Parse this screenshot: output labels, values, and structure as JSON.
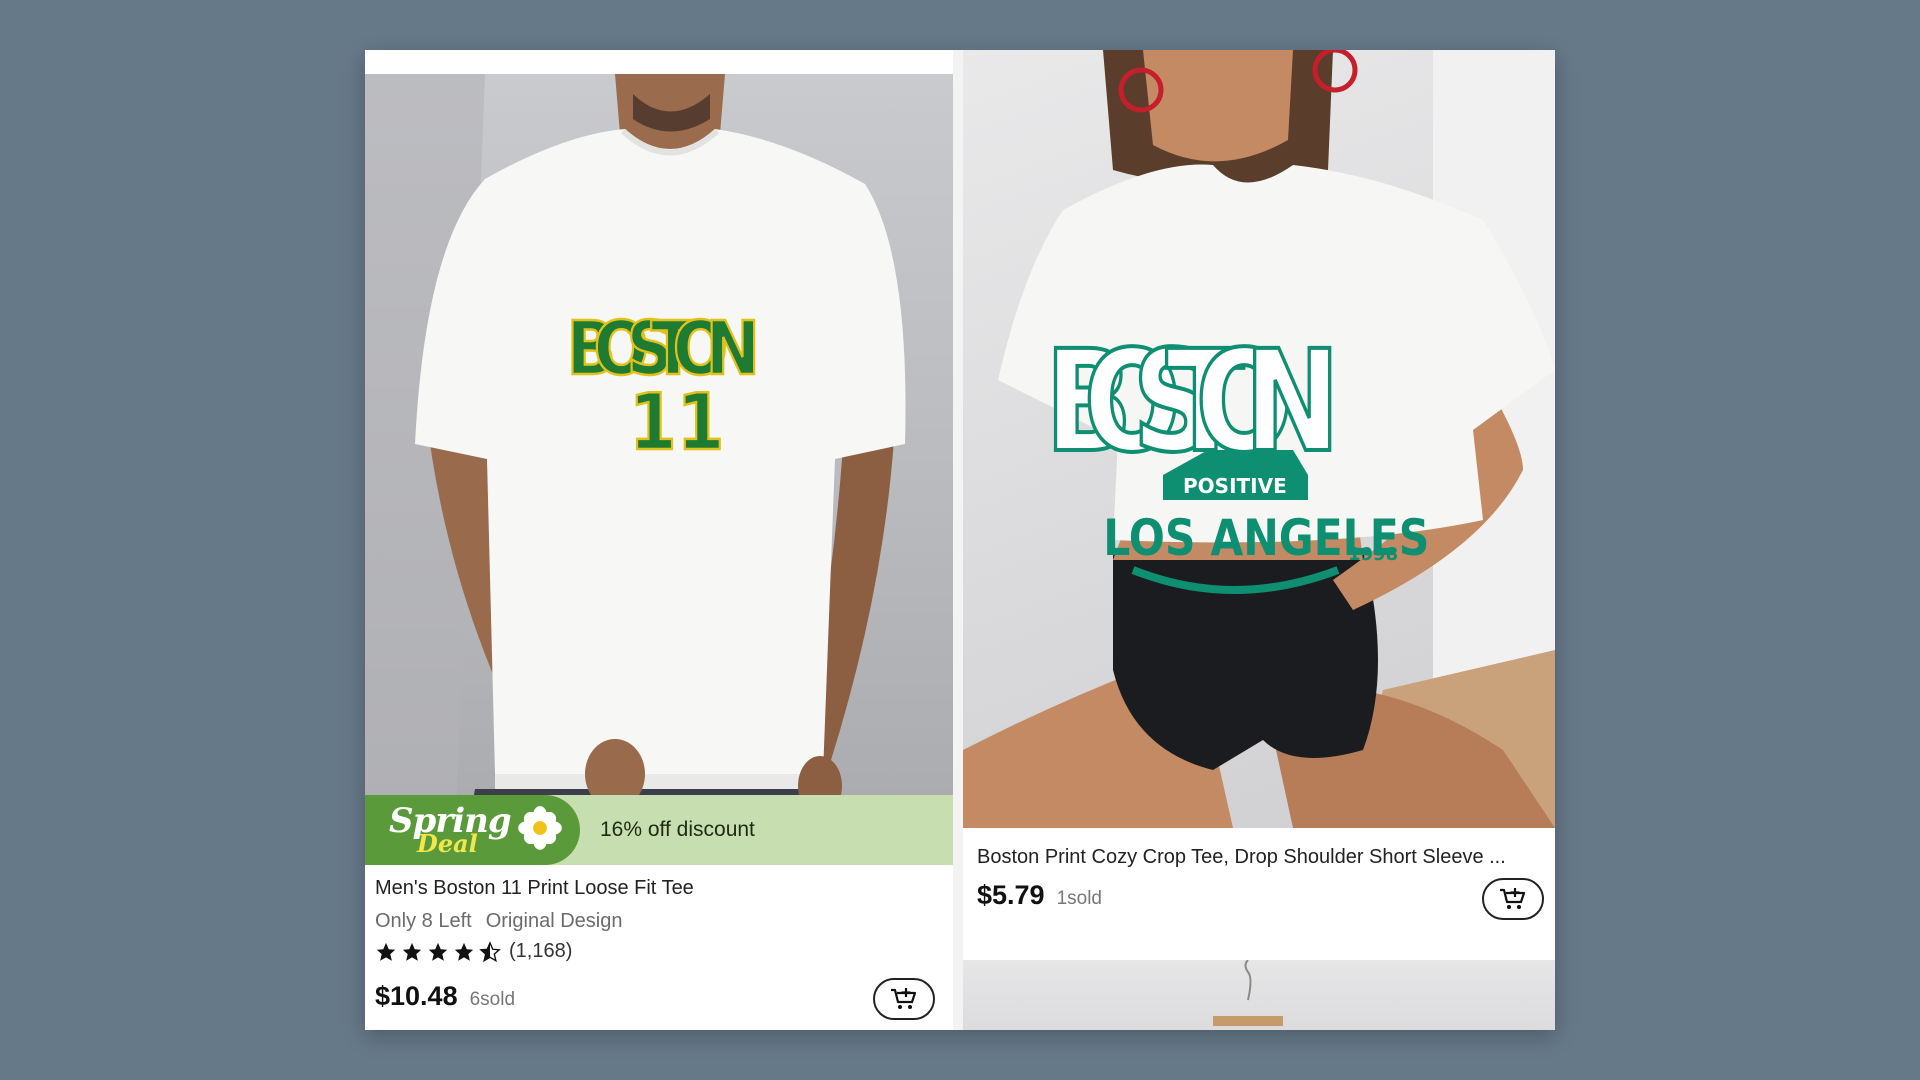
{
  "products": [
    {
      "title": "Men's Boston 11 Print Loose Fit Tee",
      "promo": {
        "badge_main": "Spring",
        "badge_sub": "Deal",
        "text": "16% off discount"
      },
      "stock": "Only 8 Left",
      "tag": "Original Design",
      "rating": {
        "stars": 4.5,
        "count": "(1,168)"
      },
      "price": "$10.48",
      "sold": "6sold",
      "print": {
        "word": "BOSTON",
        "number": "11"
      }
    },
    {
      "title": "Boston Print Cozy Crop Tee, Drop Shoulder Short Sleeve ...",
      "price": "$5.79",
      "sold": "1sold",
      "print": {
        "word": "BOSTON",
        "badge": "POSITIVE",
        "city": "LOS ANGELES",
        "year": "1998"
      }
    }
  ],
  "colors": {
    "background": "#667989",
    "promo_green": "#5b9a3a",
    "promo_light": "#c7dfb0",
    "print_green_left": "#1f7a32",
    "print_teal_right": "#0f8f72"
  },
  "icons": [
    "cart-add-icon",
    "star-icon",
    "flower-icon",
    "hanger-icon"
  ]
}
